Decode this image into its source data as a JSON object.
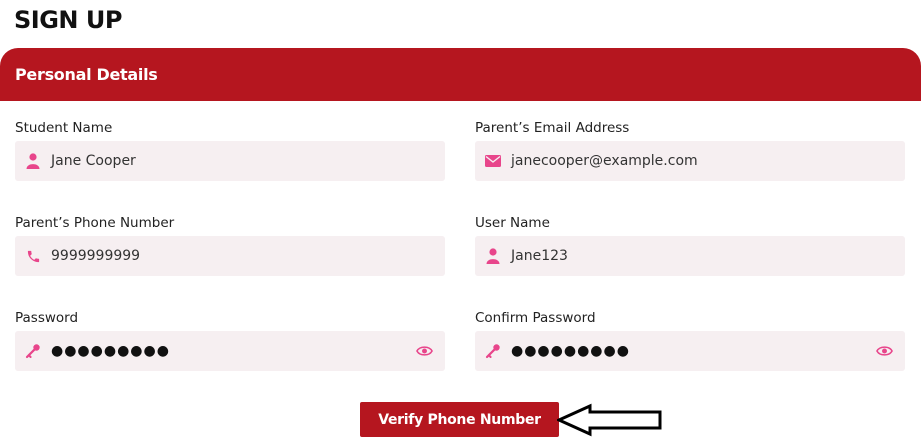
{
  "page": {
    "title": "SIGN UP"
  },
  "section": {
    "title": "Personal Details"
  },
  "fields": {
    "student_name": {
      "label": "Student Name",
      "value": "Jane Cooper",
      "icon": "person-icon"
    },
    "parent_email": {
      "label": "Parent’s Email Address",
      "value": "janecooper@example.com",
      "icon": "mail-icon"
    },
    "parent_phone": {
      "label": "Parent’s Phone Number",
      "value": "9999999999",
      "icon": "phone-icon"
    },
    "user_name": {
      "label": "User Name",
      "value": "Jane123",
      "icon": "person-icon"
    },
    "password": {
      "label": "Password",
      "value": "●●●●●●●●●",
      "icon": "key-icon"
    },
    "confirm_password": {
      "label": "Confirm Password",
      "value": "●●●●●●●●●",
      "icon": "key-icon"
    }
  },
  "actions": {
    "verify_label": "Verify Phone Number"
  },
  "colors": {
    "accent": "#b5161f",
    "icon": "#e8458b",
    "field_bg": "#f6eff1"
  }
}
